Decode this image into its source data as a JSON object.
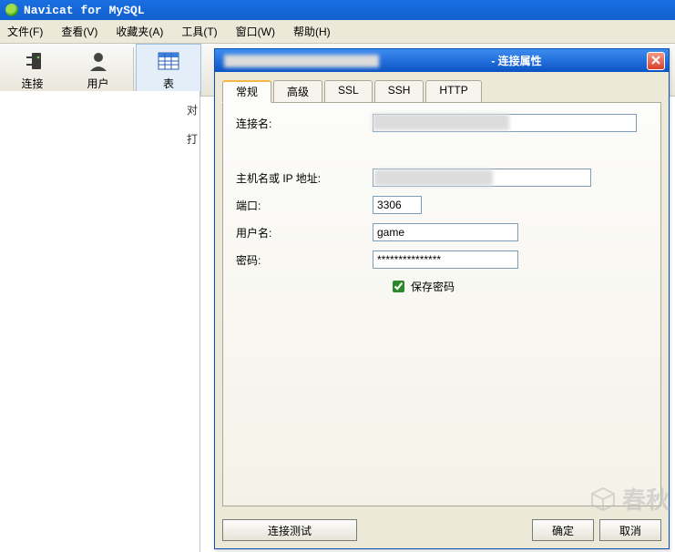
{
  "app": {
    "title": "Navicat for MySQL"
  },
  "menu": {
    "file": "文件(F)",
    "view": "查看(V)",
    "fav": "收藏夹(A)",
    "tools": "工具(T)",
    "window": "窗口(W)",
    "help": "帮助(H)"
  },
  "toolbar": {
    "connect": "连接",
    "user": "用户",
    "table": "表"
  },
  "side_labels": {
    "a": "对",
    "b": "打"
  },
  "dialog": {
    "title": "- 连接属性",
    "tabs": {
      "general": "常规",
      "advanced": "高级",
      "ssl": "SSL",
      "ssh": "SSH",
      "http": "HTTP"
    },
    "fields": {
      "name_label": "连接名:",
      "name_value": "",
      "host_label": "主机名或 IP 地址:",
      "host_value": "",
      "port_label": "端口:",
      "port_value": "3306",
      "user_label": "用户名:",
      "user_value": "game",
      "pass_label": "密码:",
      "pass_value": "***************",
      "savepass_label": "保存密码"
    },
    "buttons": {
      "test": "连接测试",
      "ok": "确定",
      "cancel": "取消"
    }
  },
  "watermark": "春秋"
}
